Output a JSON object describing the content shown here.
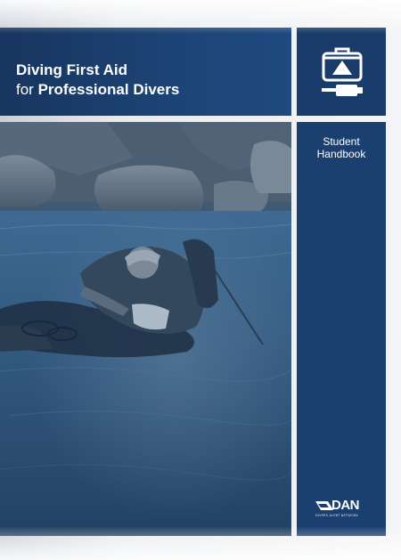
{
  "cover": {
    "title_line1": "Diving First Aid",
    "title_line2_prefix": "for ",
    "title_line2_bold": "Professional Divers",
    "subtitle_line1": "Student",
    "subtitle_line2": "Handbook",
    "publisher_logo": "DAN",
    "publisher_tagline": "DIVERS ALERT NETWORK",
    "icons": [
      "oxygen-unit-icon",
      "dan-logo-icon"
    ],
    "photo": "diver-rescue-photo"
  },
  "colors": {
    "panel_dark_blue": "#17355f",
    "panel_blue": "#1b3f6f",
    "text": "#ffffff",
    "page_background": "#e8ebee"
  }
}
